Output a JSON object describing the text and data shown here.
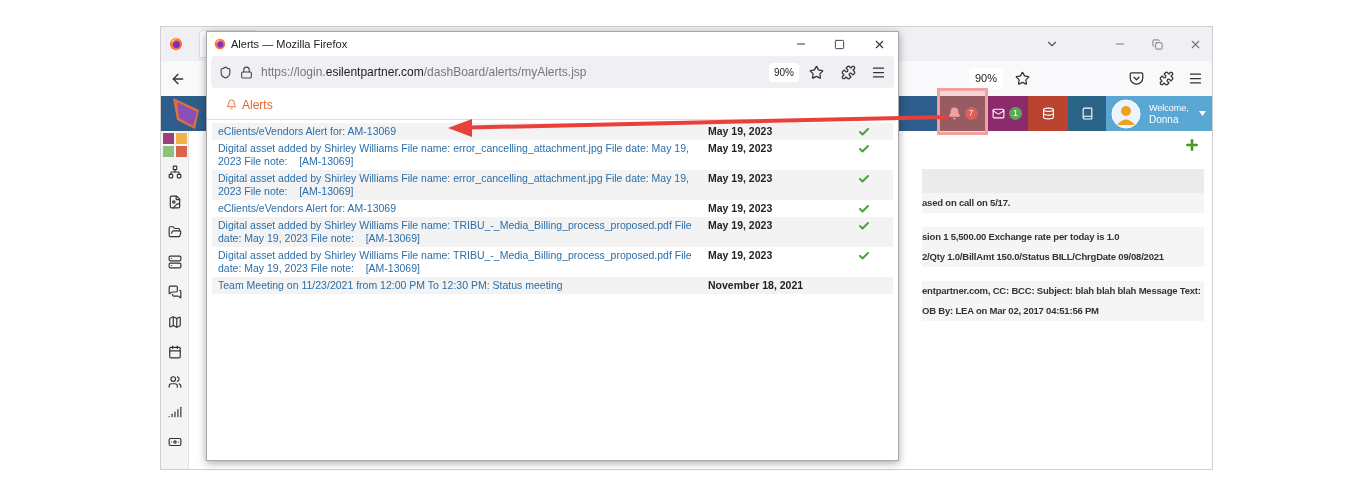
{
  "background_window": {
    "toolbar": {
      "zoom": "90%"
    },
    "header": {
      "alerts_badge": "7",
      "mail_badge": "1",
      "welcome": "Welcome,",
      "user": "Donna"
    },
    "rows": [
      {
        "text": ""
      },
      {
        "text": "ased on call on 5/17."
      },
      {
        "text": "sion 1 5,500.00 Exchange rate per today is 1.0"
      },
      {
        "text": "2/Qty 1.0/BillAmt 150.0/Status BILL/ChrgDate 09/08/2021"
      },
      {
        "text": "entpartner.com, CC: BCC: Subject: blah blah blah Message Text:"
      },
      {
        "text": "OB By: LEA on Mar 02, 2017 04:51:56 PM"
      }
    ]
  },
  "popup": {
    "title": "Alerts — Mozilla Firefox",
    "url": {
      "prefix": "https://login.",
      "domain": "esilentpartner.com",
      "path": "/dashBoard/alerts/myAlerts.jsp"
    },
    "zoom": "90%",
    "heading": "Alerts",
    "alerts": [
      {
        "text": "eClients/eVendors Alert for: AM-13069",
        "date": "May 19, 2023",
        "checked": true
      },
      {
        "text": "Digital asset added by Shirley Williams File name: error_cancelling_attachment.jpg File date: May 19, 2023 File note:    [AM-13069]",
        "date": "May 19, 2023",
        "checked": true
      },
      {
        "text": "Digital asset added by Shirley Williams File name: error_cancelling_attachment.jpg File date: May 19, 2023 File note:    [AM-13069]",
        "date": "May 19, 2023",
        "checked": true
      },
      {
        "text": "eClients/eVendors Alert for: AM-13069",
        "date": "May 19, 2023",
        "checked": true
      },
      {
        "text": "Digital asset added by Shirley Williams File name: TRIBU_-_Media_Billing_process_proposed.pdf File date: May 19, 2023 File note:    [AM-13069]",
        "date": "May 19, 2023",
        "checked": true
      },
      {
        "text": "Digital asset added by Shirley Williams File name: TRIBU_-_Media_Billing_process_proposed.pdf File date: May 19, 2023 File note:    [AM-13069]",
        "date": "May 19, 2023",
        "checked": true
      },
      {
        "text": "Team Meeting on 11/23/2021 from 12:00 PM To 12:30 PM: Status meeting",
        "date": "November 18, 2021",
        "checked": false
      }
    ]
  }
}
